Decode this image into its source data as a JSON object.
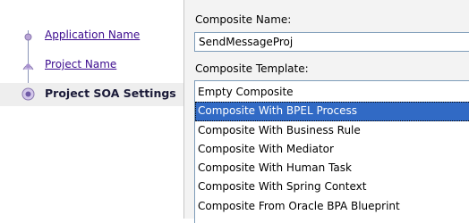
{
  "wizard": {
    "steps": [
      {
        "label": "Application Name",
        "state": "link"
      },
      {
        "label": "Project Name",
        "state": "link"
      },
      {
        "label": "Project SOA Settings",
        "state": "current"
      }
    ]
  },
  "form": {
    "composite_name_label": "Composite Name:",
    "composite_name_value": "SendMessageProj",
    "composite_template_label": "Composite Template:",
    "templates": [
      "Empty Composite",
      "Composite With BPEL Process",
      "Composite With Business Rule",
      "Composite With Mediator",
      "Composite With Human Task",
      "Composite With Spring Context",
      "Composite From Oracle BPA Blueprint"
    ],
    "selected_template": "Composite With BPEL Process"
  },
  "colors": {
    "link": "#3b0a8e",
    "selection": "#316ac5",
    "current_step_bg": "#eeeeee",
    "form_bg": "#f3f3f3"
  }
}
